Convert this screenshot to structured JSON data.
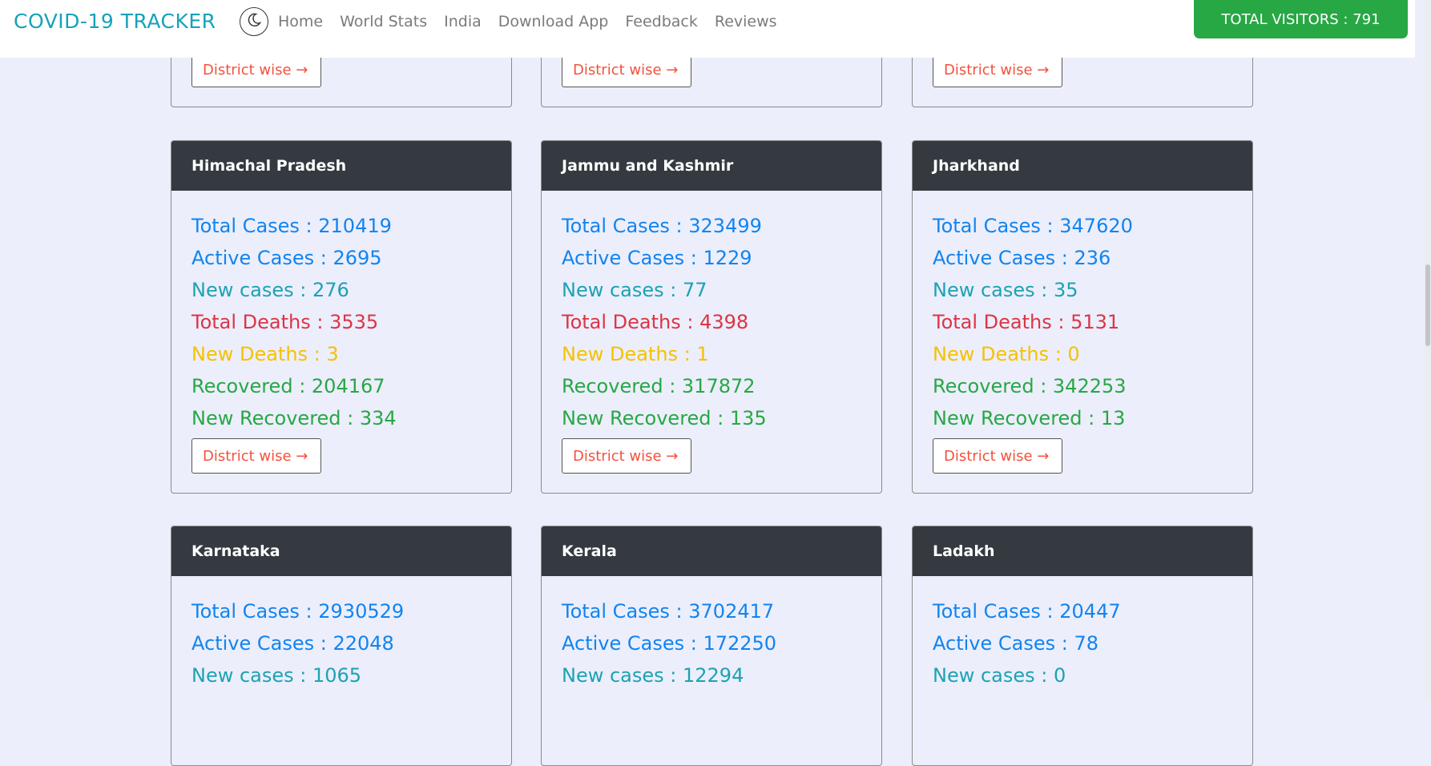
{
  "navbar": {
    "brand": "COVID-19 TRACKER",
    "theme_icon": "moon-icon",
    "links": [
      "Home",
      "World Stats",
      "India",
      "Download App",
      "Feedback",
      "Reviews"
    ],
    "visitors": "TOTAL VISITORS : 791"
  },
  "district_button": "District wise →",
  "labels": {
    "total_cases": "Total Cases",
    "active_cases": "Active Cases",
    "new_cases": "New cases",
    "total_deaths": "Total Deaths",
    "new_deaths": "New Deaths",
    "recovered": "Recovered",
    "new_recovered": "New Recovered"
  },
  "colors": {
    "header": "#343a40",
    "cases": "#1184f0",
    "new_cases": "#1ca2b4",
    "deaths": "#dc3545",
    "new_deaths": "#f6c100",
    "recovered": "#28a745",
    "button_text": "#f4513c"
  },
  "states": [
    {
      "name": "Himachal Pradesh",
      "total_cases": "210419",
      "active_cases": "2695",
      "new_cases": "276",
      "total_deaths": "3535",
      "new_deaths": "3",
      "recovered": "204167",
      "new_recovered": "334"
    },
    {
      "name": "Jammu and Kashmir",
      "total_cases": "323499",
      "active_cases": "1229",
      "new_cases": "77",
      "total_deaths": "4398",
      "new_deaths": "1",
      "recovered": "317872",
      "new_recovered": "135"
    },
    {
      "name": "Jharkhand",
      "total_cases": "347620",
      "active_cases": "236",
      "new_cases": "35",
      "total_deaths": "5131",
      "new_deaths": "0",
      "recovered": "342253",
      "new_recovered": "13"
    },
    {
      "name": "Karnataka",
      "total_cases": "2930529",
      "active_cases": "22048",
      "new_cases": "1065"
    },
    {
      "name": "Kerala",
      "total_cases": "3702417",
      "active_cases": "172250",
      "new_cases": "12294"
    },
    {
      "name": "Ladakh",
      "total_cases": "20447",
      "active_cases": "78",
      "new_cases": "0"
    }
  ]
}
